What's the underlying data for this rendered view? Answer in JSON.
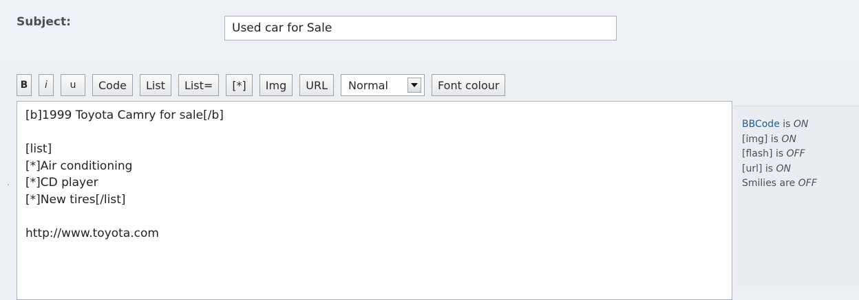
{
  "subject": {
    "label": "Subject:",
    "value": "Used car for Sale"
  },
  "toolbar": {
    "bold_label": "B",
    "italic_label": "i",
    "underline_label": "u",
    "code_label": "Code",
    "list_label": "List",
    "list_eq_label": "List=",
    "list_item_label": "[*]",
    "img_label": "Img",
    "url_label": "URL",
    "font_size_selected": "Normal",
    "font_colour_label": "Font colour"
  },
  "message": {
    "lines": [
      "[b]1999 Toyota Camry for sale[/b]",
      "",
      "[list]",
      "[*]Air conditioning",
      "[*]CD player",
      "[*]New tires[/list]",
      "",
      "http://www.toyota.com"
    ]
  },
  "options": {
    "bbcode_link": "BBCode",
    "bbcode_text": " is ",
    "bbcode_state": "ON",
    "img_text": "[img] is ",
    "img_state": "ON",
    "flash_text": "[flash] is ",
    "flash_state": "OFF",
    "url_text": "[url] is ",
    "url_state": "ON",
    "smilies_text": "Smilies are ",
    "smilies_state": "OFF"
  },
  "colors": {
    "link": "#1f5c9c",
    "label": "#47505a",
    "background": "#ecf0f4"
  },
  "icons": {
    "select_arrow": "triangle-down-icon"
  }
}
